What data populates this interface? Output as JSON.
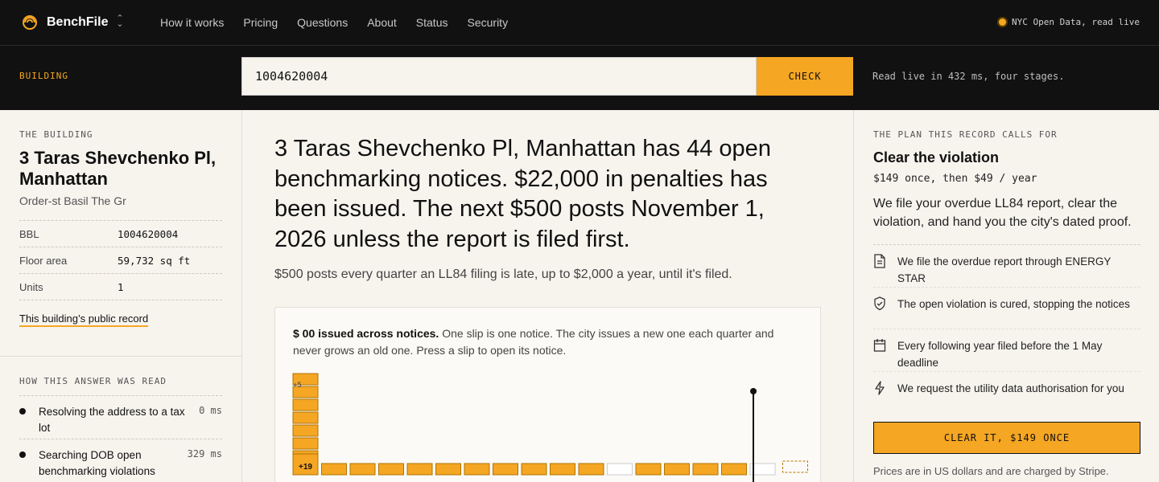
{
  "nav": {
    "brand": "BenchFile",
    "links": [
      "How it works",
      "Pricing",
      "Questions",
      "About",
      "Status",
      "Security"
    ],
    "live_status": "NYC Open Data, read live"
  },
  "search": {
    "label": "BUILDING",
    "value": "1004620004",
    "button": "CHECK",
    "note": "Read live in 432 ms, four stages."
  },
  "building": {
    "section_label": "THE BUILDING",
    "title": "3 Taras Shevchenko Pl, Manhattan",
    "subtitle": "Order-st Basil The Gr",
    "facts": [
      {
        "key": "BBL",
        "value": "1004620004"
      },
      {
        "key": "Floor area",
        "value": "59,732 sq ft"
      },
      {
        "key": "Units",
        "value": "1"
      }
    ],
    "public_record_link": "This building’s public record"
  },
  "how_read": {
    "section_label": "HOW THIS ANSWER WAS READ",
    "steps": [
      {
        "text": "Resolving the address to a tax lot",
        "ms": "0 ms"
      },
      {
        "text": "Searching DOB open benchmarking violations",
        "ms": "329 ms"
      }
    ]
  },
  "result": {
    "headline": "3 Taras Shevchenko Pl, Manhattan has 44 open benchmarking notices. $22,000 in penalties has been issued. The next $500 posts November 1, 2026 unless the report is filed first.",
    "subline": "$500 posts every quarter an LL84 filing is late, up to $2,000 a year, until it's filed."
  },
  "card": {
    "lead_bold": "$ 00 issued across notices.",
    "body": " One slip is one notice. The city issues a new one each quarter and never grows an old one. Press a slip to open its notice."
  },
  "chart_data": {
    "type": "bar",
    "stack_label": "+5",
    "overflow_badge": "+19",
    "values": [
      8,
      1,
      1,
      1,
      1,
      1,
      1,
      1,
      1,
      1,
      1,
      0,
      1,
      1,
      1,
      1,
      0,
      0
    ],
    "slip_states": [
      "issued",
      "issued",
      "issued",
      "issued",
      "issued",
      "issued",
      "issued",
      "issued",
      "issued",
      "issued",
      "issued",
      "empty",
      "issued",
      "issued",
      "issued",
      "issued",
      "empty",
      "next"
    ],
    "colors": {
      "issued": "#f5a623",
      "empty": "#ffffff",
      "outline": "#b07400"
    }
  },
  "plan": {
    "section_label": "THE PLAN THIS RECORD CALLS FOR",
    "title": "Clear the violation",
    "price": "$149 once, then $49 / year",
    "description": "We file your overdue LL84 report, clear the violation, and hand you the city's dated proof.",
    "features": [
      {
        "icon": "document-icon",
        "text": "We file the overdue report through ENERGY STAR"
      },
      {
        "icon": "shield-check-icon",
        "text": "The open violation is cured, stopping the notices"
      },
      {
        "icon": "calendar-icon",
        "text": "Every following year filed before the 1 May deadline"
      },
      {
        "icon": "lightning-icon",
        "text": "We request the utility data authorisation for you"
      }
    ],
    "cta": "CLEAR IT, $149 ONCE",
    "fine_print": "Prices are in US dollars and are charged by Stripe."
  },
  "accent": "#f5a623"
}
